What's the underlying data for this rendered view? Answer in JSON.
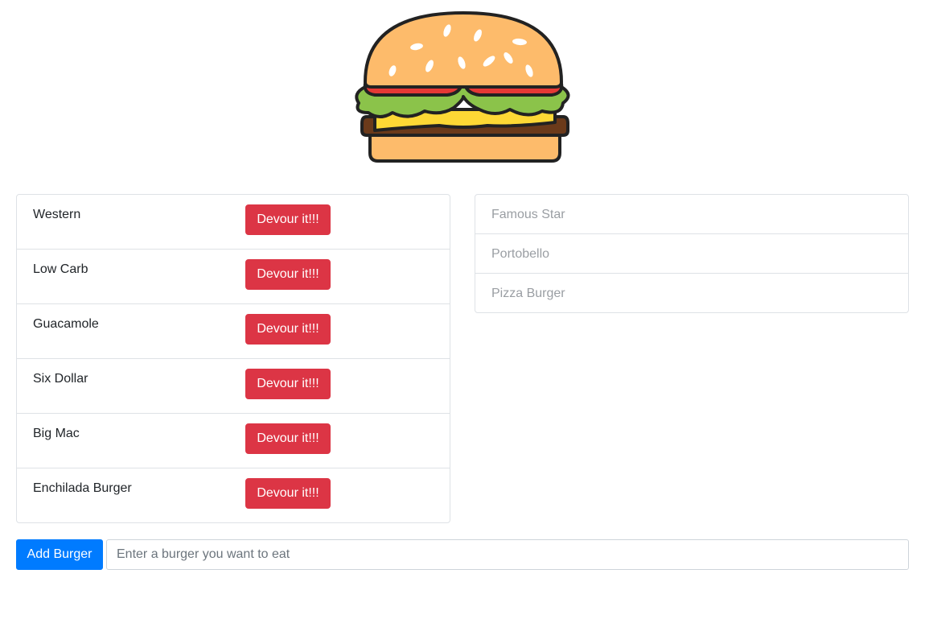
{
  "logo": {
    "icon": "burger-icon"
  },
  "uneaten": {
    "items": [
      {
        "name": "Western",
        "button_label": "Devour it!!!"
      },
      {
        "name": "Low Carb",
        "button_label": "Devour it!!!"
      },
      {
        "name": "Guacamole",
        "button_label": "Devour it!!!"
      },
      {
        "name": "Six Dollar",
        "button_label": "Devour it!!!"
      },
      {
        "name": "Big Mac",
        "button_label": "Devour it!!!"
      },
      {
        "name": "Enchilada Burger",
        "button_label": "Devour it!!!"
      }
    ]
  },
  "eaten": {
    "items": [
      {
        "name": "Famous Star"
      },
      {
        "name": "Portobello"
      },
      {
        "name": "Pizza Burger"
      }
    ]
  },
  "form": {
    "add_label": "Add Burger",
    "input_placeholder": "Enter a burger you want to eat",
    "input_value": ""
  },
  "colors": {
    "danger": "#dc3545",
    "primary": "#007bff",
    "border": "#dee2e6",
    "muted_text": "#9a9ea3"
  }
}
